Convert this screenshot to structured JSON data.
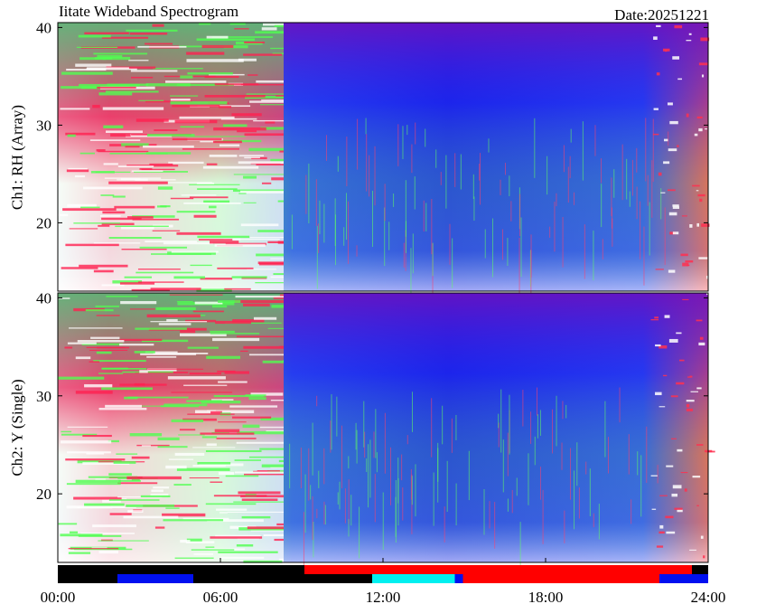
{
  "header": {
    "title": "Iitate Wideband Spectrogram",
    "date": "Date:20251221"
  },
  "chart_data": [
    {
      "type": "heatmap",
      "panel": "top",
      "ylabel": "Ch1: RH (Array)",
      "xlim": [
        0,
        24
      ],
      "ylim": [
        13,
        40.5
      ],
      "yticks": [
        20,
        30,
        40
      ],
      "ytick_labels": [
        "20",
        "30",
        "40"
      ],
      "x_unit": "hours",
      "note_colors": [
        "#ffffff",
        "#ff2050",
        "#50ff50",
        "#1020f0",
        "#6010c0"
      ]
    },
    {
      "type": "heatmap",
      "panel": "bottom",
      "ylabel": "Ch2: Y (Single)",
      "xlim": [
        0,
        24
      ],
      "ylim": [
        13,
        40.5
      ],
      "yticks": [
        20,
        30,
        40
      ],
      "ytick_labels": [
        "20",
        "30",
        "40"
      ],
      "xticks": [
        0,
        6,
        12,
        18,
        24
      ],
      "xtick_labels": [
        "00:00",
        "06:00",
        "12:00",
        "18:00",
        "24:00"
      ]
    }
  ],
  "status_bar": {
    "row1": [
      {
        "start": 0,
        "end": 9.1,
        "color": "#000000"
      },
      {
        "start": 9.1,
        "end": 23.4,
        "color": "#ff0000"
      },
      {
        "start": 23.4,
        "end": 24,
        "color": "#000000"
      }
    ],
    "row2": [
      {
        "start": 0,
        "end": 2.2,
        "color": "#000000"
      },
      {
        "start": 2.2,
        "end": 5.0,
        "color": "#0010f0"
      },
      {
        "start": 5.0,
        "end": 11.6,
        "color": "#000000"
      },
      {
        "start": 11.6,
        "end": 14.65,
        "color": "#00f0f0"
      },
      {
        "start": 14.65,
        "end": 14.95,
        "color": "#0010f0"
      },
      {
        "start": 14.95,
        "end": 22.2,
        "color": "#ff0000"
      },
      {
        "start": 22.2,
        "end": 24,
        "color": "#0010f0"
      }
    ]
  }
}
